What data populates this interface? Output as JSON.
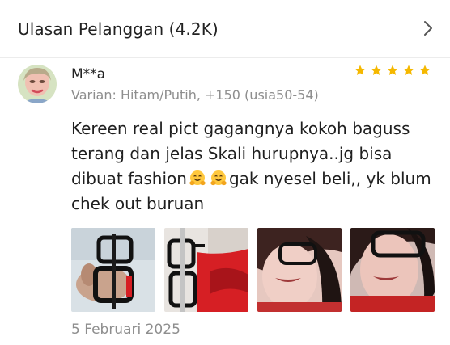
{
  "header": {
    "title": "Ulasan Pelanggan (4.2K)",
    "chevron_icon": "chevron-right-icon"
  },
  "review": {
    "username": "M**a",
    "rating": 5,
    "rating_max": 5,
    "star_color": "#f5b800",
    "variant_text": "Varian: Hitam/Putih, +150  (usia50-54)",
    "text_part1": "Kereen real pict gagangnya kokoh baguss terang dan jelas Skali hurupnya..jg bisa dibuat fashion",
    "text_part2": "gak nyesel beli,, yk blum chek out buruan",
    "emoji_icon": "hugging-face-emoji-icon",
    "photos": [
      {
        "icon": "glasses-held-in-hand-photo"
      },
      {
        "icon": "glasses-on-hanger-photo"
      },
      {
        "icon": "selfie-wearing-glasses-photo"
      },
      {
        "icon": "selfie-wearing-glasses-photo-2"
      }
    ],
    "date": "5 Februari 2025"
  },
  "colors": {
    "muted_text": "#8e8e8e",
    "divider": "#ececec",
    "accent_red": "#d61f24"
  }
}
